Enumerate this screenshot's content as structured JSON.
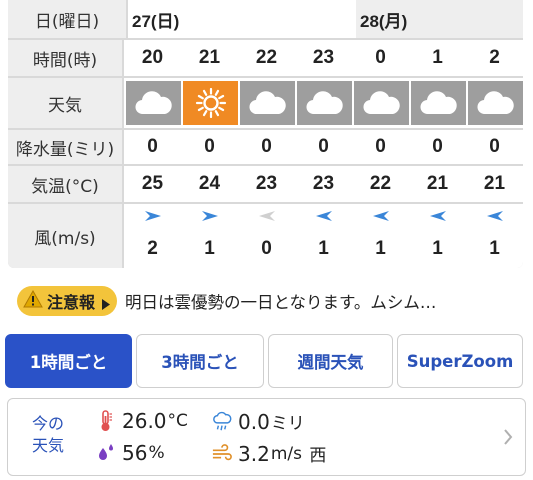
{
  "table": {
    "labels": {
      "date": "日(曜日)",
      "time": "時間(時)",
      "weather": "天気",
      "precip": "降水量(ミリ)",
      "temp": "気温(°C)",
      "wind": "風(m/s)"
    },
    "dates": [
      "27(日)",
      "28(月)"
    ],
    "hours": [
      "20",
      "21",
      "22",
      "23",
      "0",
      "1",
      "2"
    ],
    "weather": [
      "cloudy",
      "sunny",
      "cloudy",
      "cloudy",
      "cloudy",
      "cloudy",
      "cloudy"
    ],
    "precip": [
      "0",
      "0",
      "0",
      "0",
      "0",
      "0",
      "0"
    ],
    "temp": [
      "25",
      "24",
      "23",
      "23",
      "22",
      "21",
      "21"
    ],
    "wind_speed": [
      "2",
      "1",
      "0",
      "1",
      "1",
      "1",
      "1"
    ],
    "wind_dir_icon": [
      "arrow-east-icon",
      "arrow-east-icon",
      "arrow-west-icon",
      "arrow-west-icon",
      "arrow-west-icon",
      "arrow-west-icon",
      "arrow-west-icon"
    ]
  },
  "notice": {
    "badge": "注意報",
    "text": "明日は雲優勢の一日となります。ムシム…"
  },
  "tabs": [
    "1時間ごと",
    "3時間ごと",
    "週間天気",
    "SuperZoom"
  ],
  "current": {
    "title_line1": "今の",
    "title_line2": "天気",
    "temp": "26.0",
    "temp_unit": "°C",
    "humidity": "56",
    "humidity_unit": "%",
    "precip": "0.0",
    "precip_unit": "ミリ",
    "wind": "3.2",
    "wind_unit": "m/s",
    "wind_dir": "西"
  },
  "colors": {
    "accent": "#2a52c8",
    "sunny_bg": "#f08a24",
    "cloudy_bg": "#9e9e9e",
    "wind_arrow": "#3a86d8",
    "badge": "#f3c43b"
  }
}
